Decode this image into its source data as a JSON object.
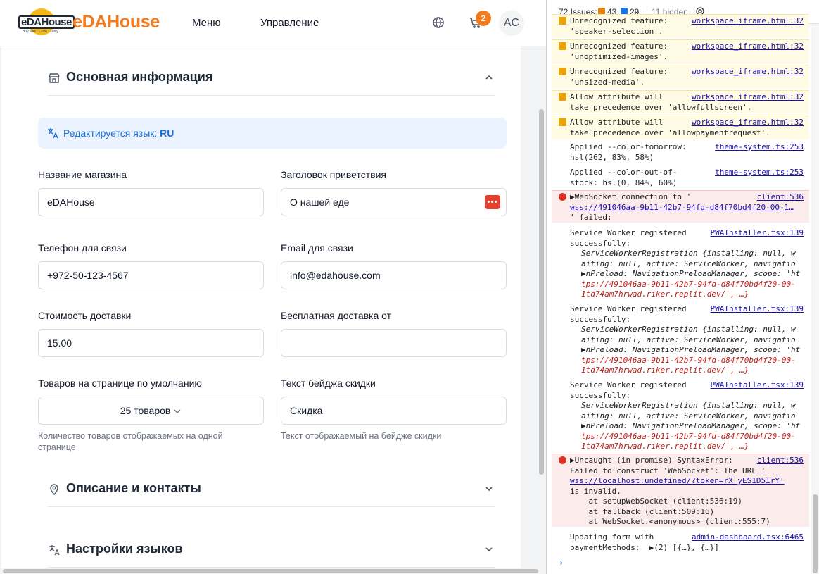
{
  "header": {
    "logo_text": "eDAHouse",
    "logo_sub": "Buy less · Cook · Tasty",
    "brand": "eDAHouse",
    "nav": [
      "Меню",
      "Управление"
    ],
    "cart_count": "2",
    "avatar": "AC",
    "brand_color": "#f47c20"
  },
  "sections": {
    "basic": "Основная информация",
    "desc": "Описание и контакты",
    "langs": "Настройки языков"
  },
  "lang_notice": {
    "text": "Редактируется язык: ",
    "code": "RU"
  },
  "form": {
    "store_name": {
      "label": "Название магазина",
      "value": "eDAHouse"
    },
    "welcome_title": {
      "label": "Заголовок приветствия",
      "value": "О нашей еде"
    },
    "phone": {
      "label": "Телефон для связи",
      "value": "+972-50-123-4567"
    },
    "email": {
      "label": "Email для связи",
      "value": "info@edahouse.com"
    },
    "delivery_cost": {
      "label": "Стоимость доставки",
      "value": "15.00"
    },
    "free_delivery": {
      "label": "Бесплатная доставка от",
      "value": ""
    },
    "per_page": {
      "label": "Товаров на странице по умолчанию",
      "value": "25 товаров",
      "hint": "Количество товаров отображаемых на одной странице"
    },
    "badge_text": {
      "label": "Текст бейджа скидки",
      "value": "Скидка",
      "hint": "Текст отображаемый на бейдже скидки"
    }
  },
  "devtools": {
    "issues_label": "72 Issues:",
    "warn_count": "43",
    "info_count": "29",
    "hidden": "11 hidden",
    "messages": [
      {
        "lines": [
          "Unrecognized feature:",
          "'speaker-selection'."
        ],
        "src": "workspace_iframe.html:32"
      },
      {
        "lines": [
          "Unrecognized feature:",
          "'unoptimized-images'."
        ],
        "src": "workspace_iframe.html:32"
      },
      {
        "lines": [
          "Unrecognized feature:",
          "'unsized-media'."
        ],
        "src": "workspace_iframe.html:32"
      },
      {
        "lines": [
          "Allow attribute will",
          "take precedence over 'allowfullscreen'."
        ],
        "src": "workspace_iframe.html:32"
      },
      {
        "lines": [
          "Allow attribute will",
          "take precedence over 'allowpaymentrequest'."
        ],
        "src": "workspace_iframe.html:32"
      },
      {
        "lines": [
          "Applied --color-tomorrow:",
          "hsl(262, 83%, 58%)"
        ],
        "src": "theme-system.ts:253"
      },
      {
        "lines": [
          "Applied --color-out-of-",
          "stock: hsl(0, 84%, 60%)"
        ],
        "src": "theme-system.ts:253"
      },
      {
        "lines": [
          "▶WebSocket connection to '",
          "wss://491046aa-9b11-42b7-94fd-d84f70bd4f20-00-1…",
          "' failed:"
        ],
        "src": "client:536"
      },
      {
        "lines": [
          "Service Worker registered",
          "successfully:",
          "ServiceWorkerRegistration {installing: null, w",
          "aiting: null, active: ServiceWorker, navigatio",
          "▶nPreload: NavigationPreloadManager, scope: 'ht",
          "tps://491046aa-9b11-42b7-94fd-d84f70bd4f20-00-",
          "1td74am7hrwad.riker.replit.dev/', …}"
        ],
        "src": "PWAInstaller.tsx:139"
      },
      {
        "lines": [
          "Service Worker registered",
          "successfully:",
          "ServiceWorkerRegistration {installing: null, w",
          "aiting: null, active: ServiceWorker, navigatio",
          "▶nPreload: NavigationPreloadManager, scope: 'ht",
          "tps://491046aa-9b11-42b7-94fd-d84f70bd4f20-00-",
          "1td74am7hrwad.riker.replit.dev/', …}"
        ],
        "src": "PWAInstaller.tsx:139"
      },
      {
        "lines": [
          "Service Worker registered",
          "successfully:",
          "ServiceWorkerRegistration {installing: null, w",
          "aiting: null, active: ServiceWorker, navigatio",
          "▶nPreload: NavigationPreloadManager, scope: 'ht",
          "tps://491046aa-9b11-42b7-94fd-d84f70bd4f20-00-",
          "1td74am7hrwad.riker.replit.dev/', …}"
        ],
        "src": "PWAInstaller.tsx:139"
      },
      {
        "lines": [
          "▶Uncaught (in promise) SyntaxError:",
          "Failed to construct 'WebSocket': The URL '",
          "wss://localhost:undefined/?token=rX_yES1D5IrY'",
          "is invalid.",
          "    at setupWebSocket (client:536:19)",
          "    at fallback (client:509:16)",
          "    at WebSocket.<anonymous> (client:555:7)"
        ],
        "src": "client:536"
      },
      {
        "lines": [
          "Updating form with",
          "paymentMethods:  ▶(2) [{…}, {…}]"
        ],
        "src": "admin-dashboard.tsx:6465"
      }
    ],
    "prompt": "›"
  }
}
